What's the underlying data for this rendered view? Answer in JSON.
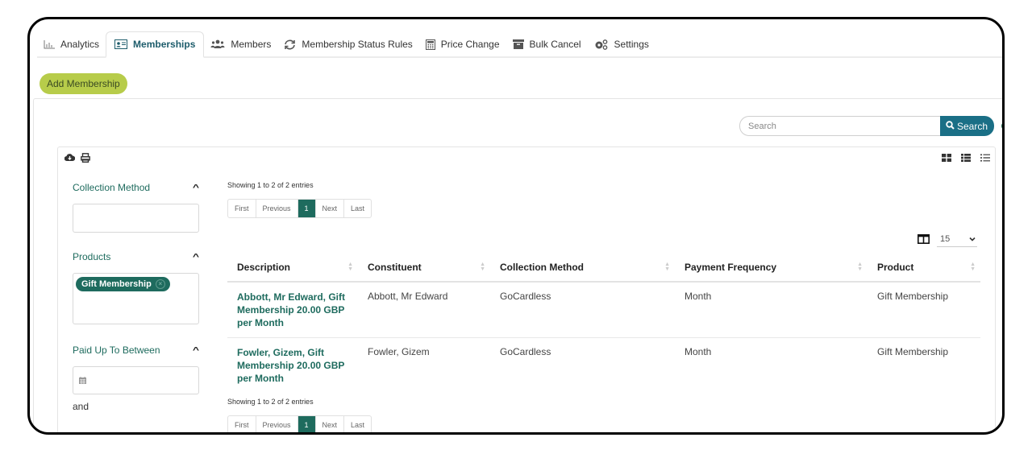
{
  "tabs": [
    {
      "label": "Analytics",
      "icon": "bar-chart-icon",
      "active": false
    },
    {
      "label": "Memberships",
      "icon": "id-card-icon",
      "active": true
    },
    {
      "label": "Members",
      "icon": "users-icon",
      "active": false
    },
    {
      "label": "Membership Status Rules",
      "icon": "refresh-icon",
      "active": false
    },
    {
      "label": "Price Change",
      "icon": "calculator-icon",
      "active": false
    },
    {
      "label": "Bulk Cancel",
      "icon": "archive-icon",
      "active": false
    },
    {
      "label": "Settings",
      "icon": "cogs-icon",
      "active": false
    }
  ],
  "actions": {
    "add_membership": "Add Membership"
  },
  "search": {
    "placeholder": "Search",
    "button_label": "Search",
    "help": "?"
  },
  "filters": {
    "collection_method": {
      "label": "Collection Method",
      "value": ""
    },
    "products": {
      "label": "Products",
      "chips": [
        "Gift Membership"
      ]
    },
    "paid_up_to": {
      "label": "Paid Up To Between",
      "and_label": "and"
    }
  },
  "pagination": {
    "info": "Showing 1 to 2 of 2 entries",
    "first": "First",
    "previous": "Previous",
    "current": "1",
    "next": "Next",
    "last": "Last"
  },
  "per_page": "15",
  "table": {
    "columns": [
      "Description",
      "Constituent",
      "Collection Method",
      "Payment Frequency",
      "Product"
    ],
    "rows": [
      {
        "description": "Abbott, Mr Edward, Gift Membership 20.00 GBP per Month",
        "constituent": "Abbott, Mr Edward",
        "collection_method": "GoCardless",
        "payment_frequency": "Month",
        "product": "Gift Membership"
      },
      {
        "description": "Fowler, Gizem, Gift Membership 20.00 GBP per Month",
        "constituent": "Fowler, Gizem",
        "collection_method": "GoCardless",
        "payment_frequency": "Month",
        "product": "Gift Membership"
      }
    ]
  },
  "colors": {
    "primary": "#1e6b5e",
    "search_button": "#1a6f86",
    "add_button": "#b7cc4a"
  }
}
